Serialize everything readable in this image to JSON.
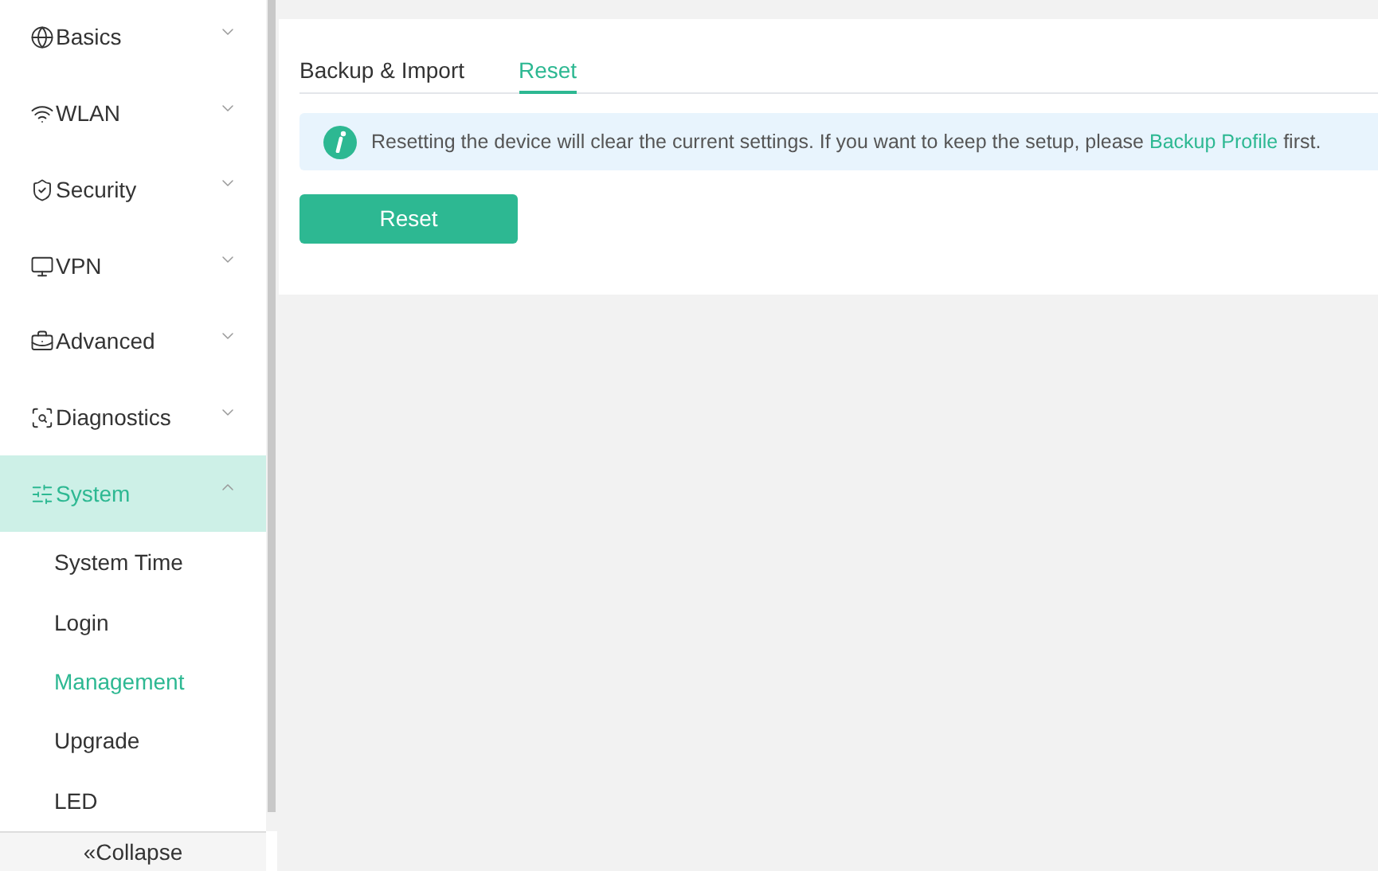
{
  "sidebar": {
    "items": [
      {
        "label": "Basics",
        "kind": "globe",
        "expanded": false,
        "selected": false
      },
      {
        "label": "WLAN",
        "kind": "wifi",
        "expanded": false,
        "selected": false
      },
      {
        "label": "Security",
        "kind": "shield",
        "expanded": false,
        "selected": false
      },
      {
        "label": "VPN",
        "kind": "monitor",
        "expanded": false,
        "selected": false
      },
      {
        "label": "Advanced",
        "kind": "briefcase",
        "expanded": false,
        "selected": false
      },
      {
        "label": "Diagnostics",
        "kind": "scan",
        "expanded": false,
        "selected": false
      },
      {
        "label": "System",
        "kind": "sliders",
        "expanded": true,
        "selected": true,
        "children": [
          {
            "label": "System Time",
            "selected": false
          },
          {
            "label": "Login",
            "selected": false
          },
          {
            "label": "Management",
            "selected": true
          },
          {
            "label": "Upgrade",
            "selected": false
          },
          {
            "label": "LED",
            "selected": false
          }
        ]
      }
    ],
    "collapse": {
      "icon": "«",
      "label": "Collapse"
    }
  },
  "tabs": [
    {
      "label": "Backup & Import",
      "selected": false
    },
    {
      "label": "Reset",
      "selected": true
    }
  ],
  "notice": {
    "before": "Resetting the device will clear the current settings. If you want to keep the setup, please",
    "link": "Backup Profile",
    "after": "first."
  },
  "reset_button": "Reset"
}
